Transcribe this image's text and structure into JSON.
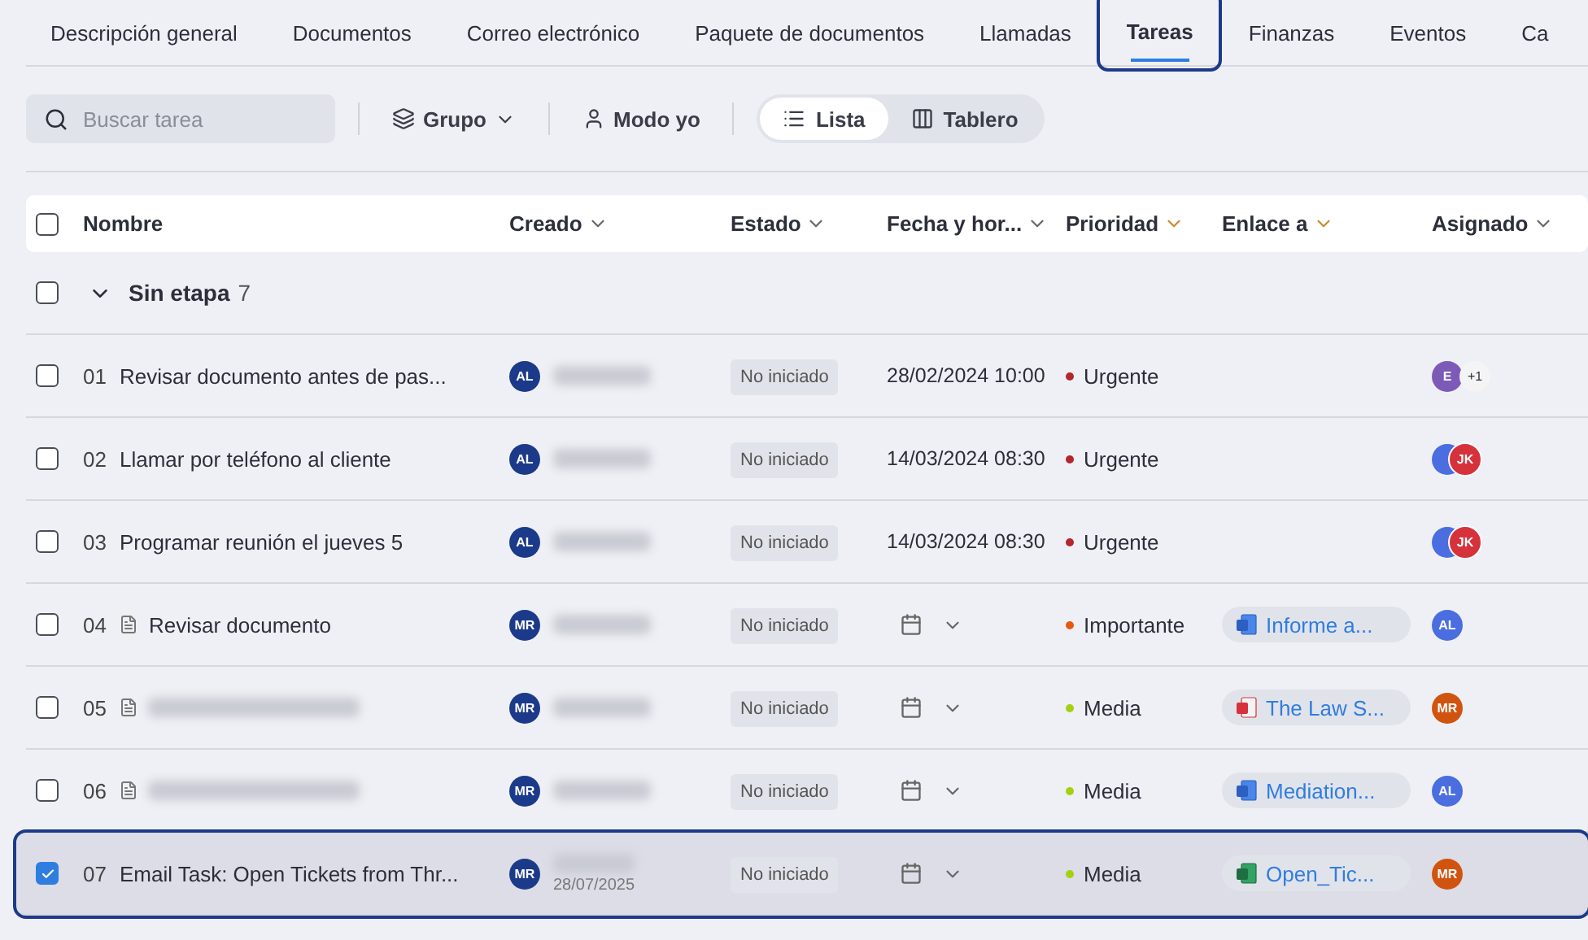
{
  "tabs": [
    {
      "label": "Descripción general",
      "selected": false
    },
    {
      "label": "Documentos",
      "selected": false
    },
    {
      "label": "Correo electrónico",
      "selected": false
    },
    {
      "label": "Paquete de documentos",
      "selected": false
    },
    {
      "label": "Llamadas",
      "selected": false
    },
    {
      "label": "Tareas",
      "selected": true
    },
    {
      "label": "Finanzas",
      "selected": false
    },
    {
      "label": "Eventos",
      "selected": false
    },
    {
      "label": "Ca",
      "selected": false
    }
  ],
  "toolbar": {
    "search": {
      "placeholder": "Buscar tarea"
    },
    "group": "Grupo",
    "me_mode": "Modo yo",
    "views": [
      {
        "label": "Lista",
        "selected": true,
        "kind": "list"
      },
      {
        "label": "Tablero",
        "selected": false,
        "kind": "board"
      }
    ]
  },
  "table": {
    "header_checked": false,
    "columns": [
      {
        "label": "Nombre",
        "sortable": false
      },
      {
        "label": "Creado",
        "sortable": true
      },
      {
        "label": "Estado",
        "sortable": true
      },
      {
        "label": "Fecha y hor...",
        "sortable": true
      },
      {
        "label": "Prioridad",
        "sortable": true
      },
      {
        "label": "Enlace a",
        "sortable": true
      },
      {
        "label": "Asignado",
        "sortable": true
      }
    ],
    "group": {
      "label": "Sin etapa",
      "count": "7",
      "checked": false,
      "expanded": true
    },
    "rows": [
      {
        "number": "01",
        "name": "Revisar documento antes de pas...",
        "doc_icon": false,
        "checked": false,
        "creator": {
          "initials": "AL",
          "blurred": true
        },
        "status": "No iniciado",
        "due": "28/02/2024 10:00",
        "priority": {
          "label": "Urgente",
          "color": "#b3262e"
        },
        "assignees": [
          {
            "initials": "E",
            "color": "#7e5ab8"
          }
        ],
        "more": "+1"
      },
      {
        "number": "02",
        "name": "Llamar por teléfono al cliente",
        "doc_icon": false,
        "checked": false,
        "creator": {
          "initials": "AL",
          "blurred": true
        },
        "status": "No iniciado",
        "due": "14/03/2024 08:30",
        "priority": {
          "label": "Urgente",
          "color": "#b3262e"
        },
        "assignees": [
          {
            "color": "#4a6ee0"
          },
          {
            "initials": "JK",
            "color": "#d6323c"
          }
        ]
      },
      {
        "number": "03",
        "name": "Programar reunión el jueves 5",
        "doc_icon": false,
        "checked": false,
        "creator": {
          "initials": "AL",
          "blurred": true
        },
        "status": "No iniciado",
        "due": "14/03/2024 08:30",
        "priority": {
          "label": "Urgente",
          "color": "#b3262e"
        },
        "assignees": [
          {
            "color": "#4a6ee0"
          },
          {
            "initials": "JK",
            "color": "#d6323c"
          }
        ]
      },
      {
        "number": "04",
        "name": "Revisar documento",
        "doc_icon": true,
        "checked": false,
        "creator": {
          "initials": "MR",
          "blurred": true
        },
        "status": "No iniciado",
        "priority": {
          "label": "Importante",
          "color": "#e8590c"
        },
        "link": {
          "label": "Informe a...",
          "kind": "word"
        },
        "assignees": [
          {
            "initials": "AL",
            "color": "#4a6ee0"
          }
        ]
      },
      {
        "number": "05",
        "name_blurred": true,
        "doc_icon": true,
        "checked": false,
        "creator": {
          "initials": "MR",
          "blurred": true
        },
        "status": "No iniciado",
        "priority": {
          "label": "Media",
          "color": "#a3d10e"
        },
        "link": {
          "label": "The Law S...",
          "kind": "pdf"
        },
        "assignees": [
          {
            "initials": "MR",
            "color": "#d0540f"
          }
        ]
      },
      {
        "number": "06",
        "name_blurred": true,
        "doc_icon": true,
        "checked": false,
        "creator": {
          "initials": "MR",
          "blurred": true
        },
        "status": "No iniciado",
        "priority": {
          "label": "Media",
          "color": "#a3d10e"
        },
        "link": {
          "label": "Mediation...",
          "kind": "word"
        },
        "assignees": [
          {
            "initials": "AL",
            "color": "#4a6ee0"
          }
        ]
      },
      {
        "number": "07",
        "name": "Email Task: Open Tickets from Thr...",
        "doc_icon": false,
        "checked": true,
        "creator": {
          "initials": "MR",
          "blurred": true,
          "date": "28/07/2025"
        },
        "status": "No iniciado",
        "priority": {
          "label": "Media",
          "color": "#a3d10e"
        },
        "link": {
          "label": "Open_Tic...",
          "kind": "excel"
        },
        "assignees": [
          {
            "initials": "MR",
            "color": "#d0540f"
          }
        ]
      }
    ]
  }
}
